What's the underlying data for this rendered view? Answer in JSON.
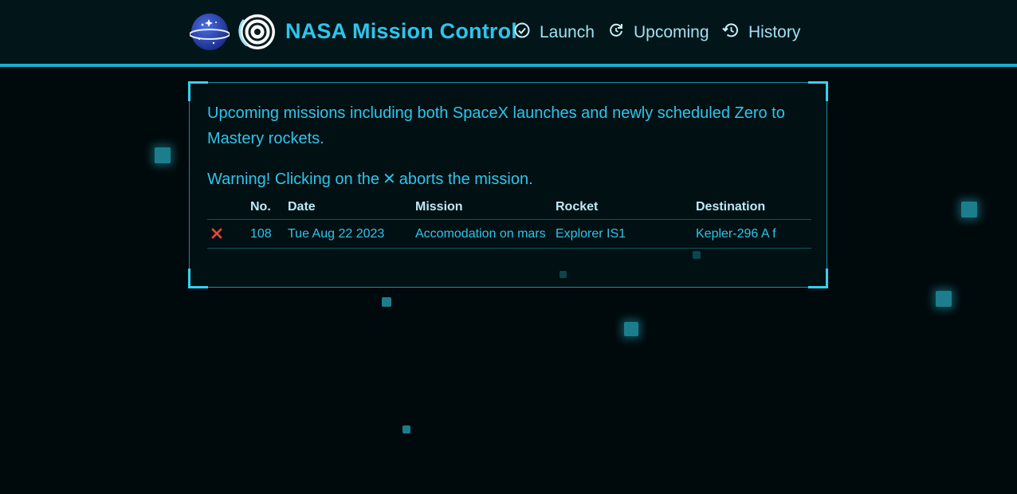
{
  "header": {
    "brand": "NASA Mission Control",
    "nav": [
      {
        "label": "Launch",
        "icon": "check-circle-icon"
      },
      {
        "label": "Upcoming",
        "icon": "refresh-icon"
      },
      {
        "label": "History",
        "icon": "history-icon"
      }
    ]
  },
  "content": {
    "intro": "Upcoming missions including both SpaceX launches and newly scheduled Zero to Mastery rockets.",
    "warning_prefix": "Warning! Clicking on the",
    "warning_symbol": "✕",
    "warning_suffix": "aborts the mission."
  },
  "table": {
    "columns": [
      "",
      "No.",
      "Date",
      "Mission",
      "Rocket",
      "Destination"
    ],
    "rows": [
      {
        "abort_icon": "abort-x-icon",
        "no": "108",
        "date": "Tue Aug 22 2023",
        "mission": "Accomodation on mars",
        "rocket": "Explorer IS1",
        "destination": "Kepler-296 A f"
      }
    ]
  },
  "colors": {
    "accent": "#26c6e6",
    "background": "#000a0c",
    "header_bg": "#021519",
    "abort": "#c0392b"
  }
}
